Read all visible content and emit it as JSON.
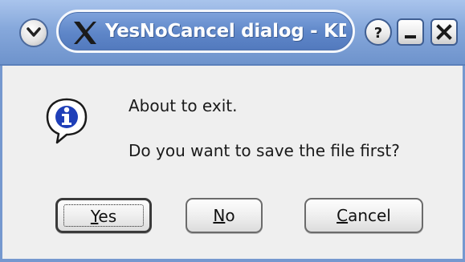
{
  "window": {
    "title": "YesNoCancel dialog - KDia",
    "title_icon": "x-logo-icon",
    "menu_icon": "chevron-down-icon",
    "help_icon": "help-icon",
    "minimize_icon": "minimize-icon",
    "close_icon": "close-icon",
    "accent": "#7598cf"
  },
  "dialog": {
    "icon": "info-icon",
    "message_line1": "About to exit.",
    "message_line2": "Do you want to save the file first?"
  },
  "buttons": {
    "yes": {
      "mnemonic": "Y",
      "rest": "es"
    },
    "no": {
      "mnemonic": "N",
      "rest": "o"
    },
    "cancel": {
      "mnemonic": "C",
      "rest": "ancel"
    }
  }
}
